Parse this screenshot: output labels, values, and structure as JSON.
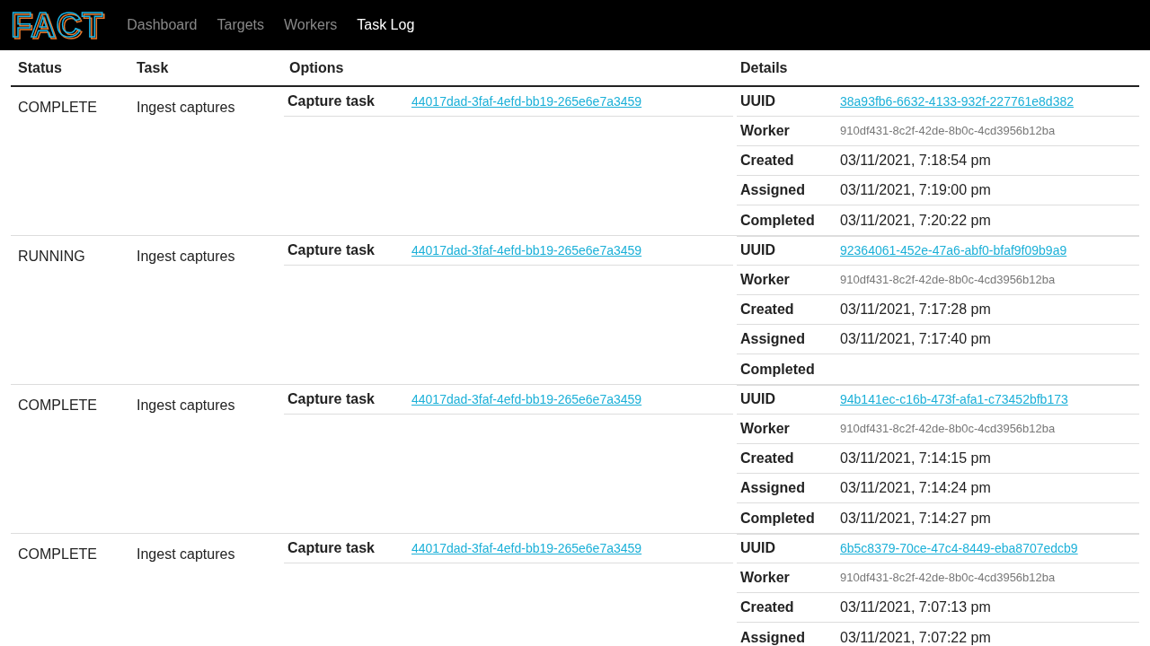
{
  "brand": "FACT",
  "nav": [
    {
      "label": "Dashboard",
      "selected": false
    },
    {
      "label": "Targets",
      "selected": false
    },
    {
      "label": "Workers",
      "selected": false
    },
    {
      "label": "Task Log",
      "selected": true
    }
  ],
  "columns": [
    "Status",
    "Task",
    "Options",
    "Details"
  ],
  "rows": [
    {
      "status": "COMPLETE",
      "task": "Ingest captures",
      "options": [
        {
          "label": "Capture task",
          "value": "44017dad-3faf-4efd-bb19-265e6e7a3459"
        }
      ],
      "details": [
        {
          "label": "UUID",
          "kind": "link",
          "value": "38a93fb6-6632-4133-932f-227761e8d382"
        },
        {
          "label": "Worker",
          "kind": "muted",
          "value": "910df431-8c2f-42de-8b0c-4cd3956b12ba"
        },
        {
          "label": "Created",
          "kind": "text",
          "value": "03/11/2021, 7:18:54 pm"
        },
        {
          "label": "Assigned",
          "kind": "text",
          "value": "03/11/2021, 7:19:00 pm"
        },
        {
          "label": "Completed",
          "kind": "text",
          "value": "03/11/2021, 7:20:22 pm"
        }
      ]
    },
    {
      "status": "RUNNING",
      "task": "Ingest captures",
      "options": [
        {
          "label": "Capture task",
          "value": "44017dad-3faf-4efd-bb19-265e6e7a3459"
        }
      ],
      "details": [
        {
          "label": "UUID",
          "kind": "link",
          "value": "92364061-452e-47a6-abf0-bfaf9f09b9a9"
        },
        {
          "label": "Worker",
          "kind": "muted",
          "value": "910df431-8c2f-42de-8b0c-4cd3956b12ba"
        },
        {
          "label": "Created",
          "kind": "text",
          "value": "03/11/2021, 7:17:28 pm"
        },
        {
          "label": "Assigned",
          "kind": "text",
          "value": "03/11/2021, 7:17:40 pm"
        },
        {
          "label": "Completed"
        }
      ]
    },
    {
      "status": "COMPLETE",
      "task": "Ingest captures",
      "options": [
        {
          "label": "Capture task",
          "value": "44017dad-3faf-4efd-bb19-265e6e7a3459"
        }
      ],
      "details": [
        {
          "label": "UUID",
          "kind": "link",
          "value": "94b141ec-c16b-473f-afa1-c73452bfb173"
        },
        {
          "label": "Worker",
          "kind": "muted",
          "value": "910df431-8c2f-42de-8b0c-4cd3956b12ba"
        },
        {
          "label": "Created",
          "kind": "text",
          "value": "03/11/2021, 7:14:15 pm"
        },
        {
          "label": "Assigned",
          "kind": "text",
          "value": "03/11/2021, 7:14:24 pm"
        },
        {
          "label": "Completed",
          "kind": "text",
          "value": "03/11/2021, 7:14:27 pm"
        }
      ]
    },
    {
      "status": "COMPLETE",
      "task": "Ingest captures",
      "options": [
        {
          "label": "Capture task",
          "value": "44017dad-3faf-4efd-bb19-265e6e7a3459"
        }
      ],
      "details": [
        {
          "label": "UUID",
          "kind": "link",
          "value": "6b5c8379-70ce-47c4-8449-eba8707edcb9"
        },
        {
          "label": "Worker",
          "kind": "muted",
          "value": "910df431-8c2f-42de-8b0c-4cd3956b12ba"
        },
        {
          "label": "Created",
          "kind": "text",
          "value": "03/11/2021, 7:07:13 pm"
        },
        {
          "label": "Assigned",
          "kind": "text",
          "value": "03/11/2021, 7:07:22 pm"
        }
      ]
    }
  ]
}
